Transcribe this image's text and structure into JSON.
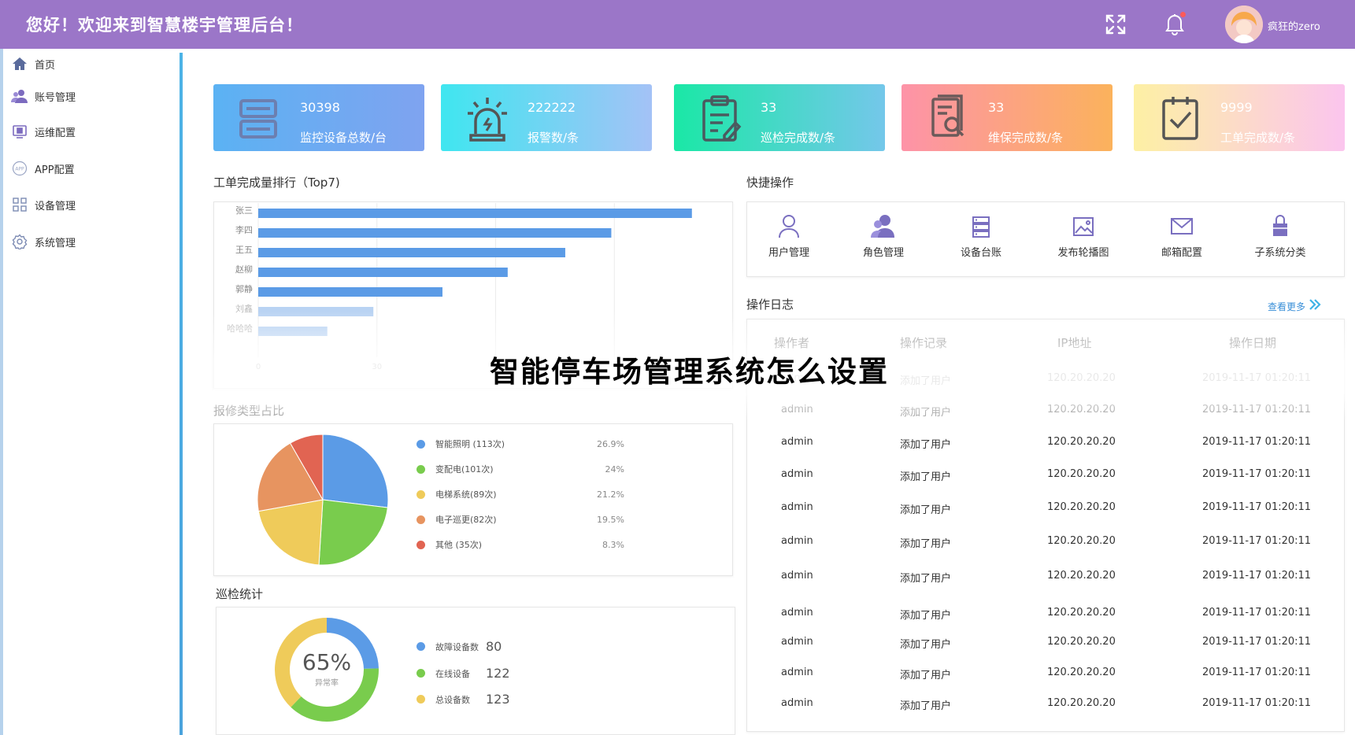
{
  "header": {
    "welcome": "您好！欢迎来到智慧楼宇管理后台！",
    "username": "疯狂的zero",
    "colors": {
      "bg": "#9b76c8",
      "notify_dot": "#ff5a5a"
    }
  },
  "sidebar": {
    "items": [
      {
        "label": "首页",
        "icon": "home-icon"
      },
      {
        "label": "账号管理",
        "icon": "users-icon"
      },
      {
        "label": "运维配置",
        "icon": "monitor-icon"
      },
      {
        "label": "APP配置",
        "icon": "app-icon"
      },
      {
        "label": "设备管理",
        "icon": "grid-icon"
      },
      {
        "label": "系统管理",
        "icon": "gear-icon"
      }
    ]
  },
  "cards": [
    {
      "value": "30398",
      "label": "监控设备总数/台",
      "icon": "server-icon"
    },
    {
      "value": "222222",
      "label": "报警数/条",
      "icon": "alarm-icon"
    },
    {
      "value": "33",
      "label": "巡检完成数/条",
      "icon": "clipboard-icon"
    },
    {
      "value": "33",
      "label": "维保完成数/条",
      "icon": "document-search-icon"
    },
    {
      "value": "9999",
      "label": "工单完成数/条",
      "icon": "checkbox-icon"
    }
  ],
  "ranking": {
    "title": "工单完成量排行（Top7)",
    "chart_data": {
      "type": "bar",
      "orientation": "horizontal",
      "categories": [
        "张三",
        "李四",
        "王五",
        "赵柳",
        "郭静",
        "刘鑫",
        "哈哈哈"
      ],
      "values": [
        113,
        92,
        80,
        65,
        48,
        30,
        18
      ],
      "xticks": [
        "0",
        "30",
        "60"
      ],
      "xlim": [
        0,
        120
      ],
      "grid": true,
      "colors": {
        "primary": "#5b9be6",
        "light": "#b9d3f3"
      }
    }
  },
  "repair": {
    "title": "报修类型占比",
    "chart_data": {
      "type": "pie",
      "slices": [
        {
          "label": "智能照明 (113次)",
          "value": 26.9,
          "pct": "26.9%",
          "color": "#5b9be6"
        },
        {
          "label": "变配电(101次)",
          "value": 24,
          "pct": "24%",
          "color": "#79cc4d"
        },
        {
          "label": "电梯系统(89次)",
          "value": 21.2,
          "pct": "21.2%",
          "color": "#efcb5a"
        },
        {
          "label": "电子巡更(82次)",
          "value": 19.5,
          "pct": "19.5%",
          "color": "#e79460"
        },
        {
          "label": "其他 (35次)",
          "value": 8.3,
          "pct": "8.3%",
          "color": "#e16452"
        }
      ]
    }
  },
  "inspection": {
    "title": "巡检统计",
    "percent": "65%",
    "percent_label": "异常率",
    "chart_data": {
      "type": "pie",
      "donut": true,
      "slices": [
        {
          "label": "故障设备数",
          "value": 80,
          "color": "#5b9be6"
        },
        {
          "label": "在线设备",
          "value": 122,
          "color": "#79cc4d"
        },
        {
          "label": "总设备数",
          "value": 123,
          "color": "#efcb5a"
        }
      ]
    }
  },
  "quick_ops": {
    "title": "快捷操作",
    "items": [
      {
        "label": "用户管理",
        "icon": "user-icon"
      },
      {
        "label": "角色管理",
        "icon": "role-icon"
      },
      {
        "label": "设备台账",
        "icon": "ledger-icon"
      },
      {
        "label": "发布轮播图",
        "icon": "image-icon"
      },
      {
        "label": "邮箱配置",
        "icon": "mail-icon"
      },
      {
        "label": "子系统分类",
        "icon": "subsystem-icon"
      }
    ]
  },
  "logs": {
    "title": "操作日志",
    "more": "查看更多",
    "columns": [
      "操作者",
      "操作记录",
      "IP地址",
      "操作日期"
    ],
    "rows": [
      {
        "operator": "admin",
        "action": "添加了用户",
        "ip": "120.20.20.20",
        "date": "2019-11-17 01:20:11"
      },
      {
        "operator": "admin",
        "action": "添加了用户",
        "ip": "120.20.20.20",
        "date": "2019-11-17 01:20:11"
      },
      {
        "operator": "admin",
        "action": "添加了用户",
        "ip": "120.20.20.20",
        "date": "2019-11-17 01:20:11"
      },
      {
        "operator": "admin",
        "action": "添加了用户",
        "ip": "120.20.20.20",
        "date": "2019-11-17 01:20:11"
      },
      {
        "operator": "admin",
        "action": "添加了用户",
        "ip": "120.20.20.20",
        "date": "2019-11-17 01:20:11"
      },
      {
        "operator": "admin",
        "action": "添加了用户",
        "ip": "120.20.20.20",
        "date": "2019-11-17 01:20:11"
      },
      {
        "operator": "admin",
        "action": "添加了用户",
        "ip": "120.20.20.20",
        "date": "2019-11-17 01:20:11"
      },
      {
        "operator": "admin",
        "action": "添加了用户",
        "ip": "120.20.20.20",
        "date": "2019-11-17 01:20:11"
      },
      {
        "operator": "admin",
        "action": "添加了用户",
        "ip": "120.20.20.20",
        "date": "2019-11-17 01:20:11"
      },
      {
        "operator": "admin",
        "action": "添加了用户",
        "ip": "120.20.20.20",
        "date": "2019-11-17 01:20:11"
      },
      {
        "operator": "admin",
        "action": "添加了用户",
        "ip": "120.20.20.20",
        "date": "2019-11-17 01:20:11"
      }
    ]
  },
  "overlay_title": "智能停车场管理系统怎么设置"
}
